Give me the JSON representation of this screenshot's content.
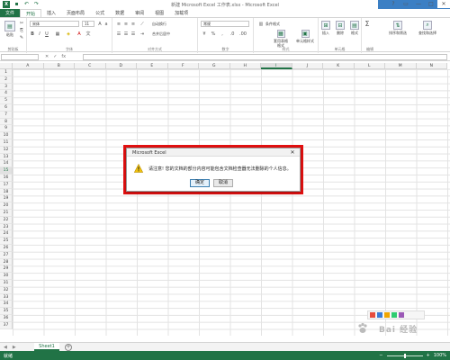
{
  "window": {
    "title": "新建 Microsoft Excel 工作表.xlsx - Microsoft Excel",
    "controls": [
      "?",
      "▭",
      "—",
      "□",
      "✕"
    ]
  },
  "qat": {
    "undo": "↶",
    "redo": "↷",
    "save": "💾"
  },
  "ribbon_tabs": [
    "文件",
    "开始",
    "插入",
    "页面布局",
    "公式",
    "数据",
    "审阅",
    "视图",
    "加载项"
  ],
  "ribbon": {
    "clipboard_label": "剪贴板",
    "paste": "粘贴",
    "font_label": "字体",
    "font_name": "宋体",
    "font_size": "11",
    "align_label": "对齐方式",
    "wrap_text": "自动换行",
    "merge_center": "合并后居中",
    "number_label": "数字",
    "number_format": "常规",
    "styles_label": "样式",
    "cond_format": "条件格式",
    "table_format": "套用表格格式",
    "cell_styles": "单元格样式",
    "cells_label": "单元格",
    "insert": "插入",
    "delete": "删除",
    "format": "格式",
    "edit_label": "编辑",
    "sort_filter": "排序和筛选",
    "find_select": "查找和选择"
  },
  "formula_bar": {
    "name_box": "",
    "fx": "fx",
    "value": ""
  },
  "columns": [
    "A",
    "B",
    "C",
    "D",
    "E",
    "F",
    "G",
    "H",
    "I",
    "J",
    "K",
    "L",
    "M",
    "N"
  ],
  "selected_column": "I",
  "rows": [
    "1",
    "2",
    "3",
    "4",
    "5",
    "6",
    "7",
    "8",
    "9",
    "10",
    "11",
    "12",
    "13",
    "14",
    "15",
    "16",
    "17",
    "18",
    "19",
    "20",
    "21",
    "22",
    "23",
    "24",
    "25",
    "26",
    "27",
    "28",
    "29",
    "30",
    "31",
    "32",
    "33",
    "34",
    "35",
    "36",
    "37"
  ],
  "selected_row": "15",
  "sheet_tabs": [
    "Sheet1"
  ],
  "status": {
    "left": "就绪",
    "zoom": "100%"
  },
  "dialog": {
    "title": "Microsoft Excel",
    "message": "请注意! 您的文档的部分内容可能包含文档检查器无法删除的个人信息。",
    "ok": "确定",
    "cancel": "取消",
    "icon": "warning-icon"
  },
  "watermark": {
    "text": "Bai 经验",
    "sub": "jingyan.baidu.com"
  },
  "colors": {
    "excel_green": "#217346",
    "highlight_red": "#e31010",
    "corner_blue": "#3b7fc4"
  }
}
